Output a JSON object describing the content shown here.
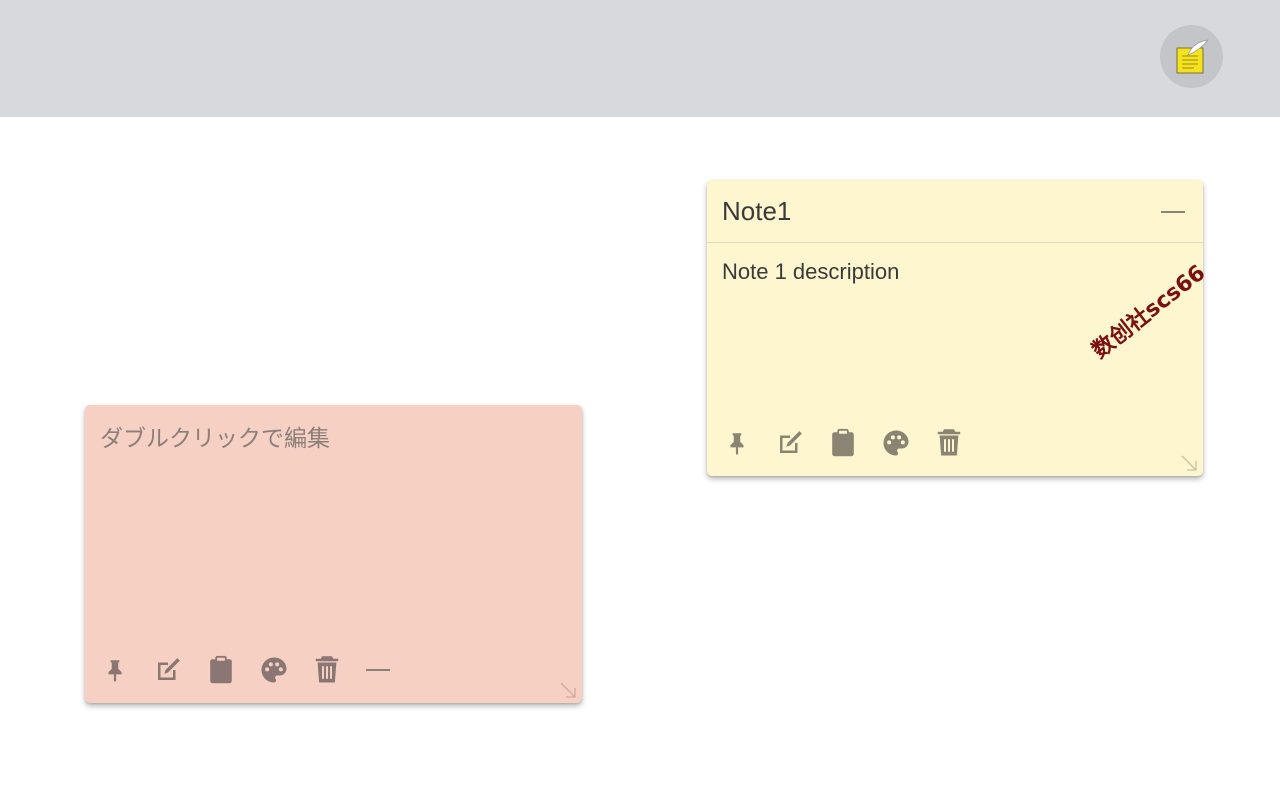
{
  "colors": {
    "topbar": "#d8d9dd",
    "note_yellow": "#fef6cf",
    "note_pink": "#f7d0c4",
    "icon_yellow": "#8a8472",
    "icon_pink": "#8a7773"
  },
  "notes": [
    {
      "title": "Note1",
      "description": "Note 1 description",
      "color": "yellow",
      "toolbar": [
        "pin-icon",
        "edit-icon",
        "clipboard-icon",
        "palette-icon",
        "trash-icon"
      ]
    },
    {
      "placeholder": "ダブルクリックで編集",
      "color": "pink",
      "toolbar": [
        "pin-icon",
        "edit-icon",
        "clipboard-icon",
        "palette-icon",
        "trash-icon",
        "minimize-icon"
      ]
    }
  ],
  "watermark": "数创社scs66"
}
